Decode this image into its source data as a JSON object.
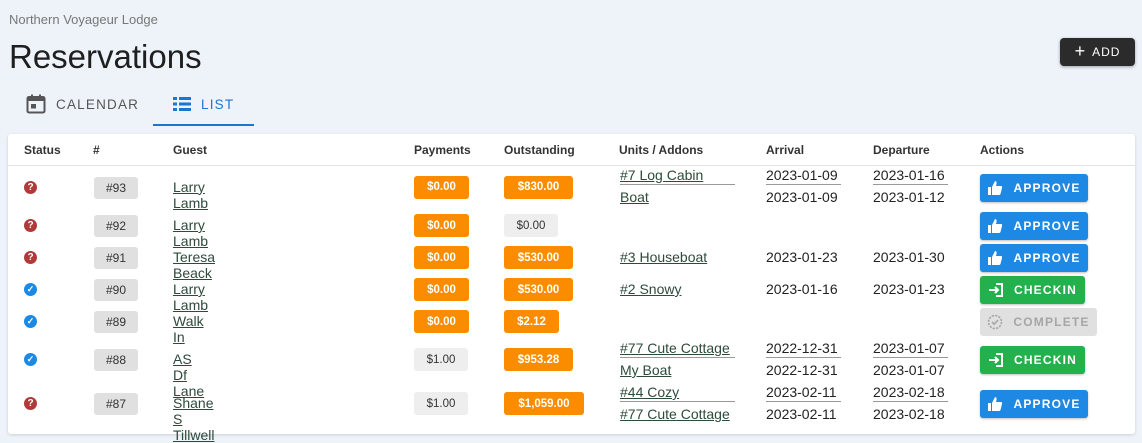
{
  "app": {
    "org_name": "Northern Voyageur Lodge",
    "page_title": "Reservations"
  },
  "toolbar": {
    "add_label": "ADD"
  },
  "tabs": [
    {
      "label": "CALENDAR",
      "icon": "calendar-icon",
      "active": false
    },
    {
      "label": "LIST",
      "icon": "list-icon",
      "active": true
    }
  ],
  "table": {
    "columns": [
      "Status",
      "#",
      "Guest",
      "Payments",
      "Outstanding",
      "Units / Addons",
      "Arrival",
      "Departure",
      "Actions"
    ],
    "rows": [
      {
        "status": "pending",
        "id": "#93",
        "guest": "Larry Lamb",
        "payments": "$0.00",
        "payments_color": "orange",
        "outstanding": "$830.00",
        "outstanding_color": "orange",
        "units": [
          "#7 Log Cabin",
          "Boat"
        ],
        "arrival": [
          "2023-01-09",
          "2023-01-09"
        ],
        "departure": [
          "2023-01-16",
          "2023-01-12"
        ],
        "action": "APPROVE",
        "action_type": "approve"
      },
      {
        "status": "pending",
        "id": "#92",
        "guest": "Larry Lamb",
        "payments": "$0.00",
        "payments_color": "orange",
        "outstanding": "$0.00",
        "outstanding_color": "gray",
        "units": [],
        "arrival": [],
        "departure": [],
        "action": "APPROVE",
        "action_type": "approve"
      },
      {
        "status": "pending",
        "id": "#91",
        "guest": "Teresa Beack",
        "payments": "$0.00",
        "payments_color": "orange",
        "outstanding": "$530.00",
        "outstanding_color": "orange",
        "units": [
          "#3 Houseboat"
        ],
        "arrival": [
          "2023-01-23"
        ],
        "departure": [
          "2023-01-30"
        ],
        "action": "APPROVE",
        "action_type": "approve"
      },
      {
        "status": "confirmed",
        "id": "#90",
        "guest": "Larry Lamb",
        "payments": "$0.00",
        "payments_color": "orange",
        "outstanding": "$530.00",
        "outstanding_color": "orange",
        "units": [
          "#2 Snowy"
        ],
        "arrival": [
          "2023-01-16"
        ],
        "departure": [
          "2023-01-23"
        ],
        "action": "CHECKIN",
        "action_type": "checkin"
      },
      {
        "status": "confirmed",
        "id": "#89",
        "guest": "Walk In",
        "payments": "$0.00",
        "payments_color": "orange",
        "outstanding": "$2.12",
        "outstanding_color": "orange",
        "units": [],
        "arrival": [],
        "departure": [],
        "action": "COMPLETE",
        "action_type": "complete"
      },
      {
        "status": "confirmed",
        "id": "#88",
        "guest": "AS Df Lane",
        "payments": "$1.00",
        "payments_color": "gray",
        "outstanding": "$953.28",
        "outstanding_color": "orange",
        "units": [
          "#77 Cute Cottage",
          "My Boat"
        ],
        "arrival": [
          "2022-12-31",
          "2022-12-31"
        ],
        "departure": [
          "2023-01-07",
          "2023-01-07"
        ],
        "action": "CHECKIN",
        "action_type": "checkin"
      },
      {
        "status": "pending",
        "id": "#87",
        "guest": "Shane S Tillwell",
        "payments": "$1.00",
        "payments_color": "gray",
        "outstanding": "$1,059.00",
        "outstanding_color": "orange",
        "units": [
          "#44 Cozy",
          "#77 Cute Cottage"
        ],
        "arrival": [
          "2023-02-11",
          "2023-02-11"
        ],
        "departure": [
          "2023-02-18",
          "2023-02-18"
        ],
        "action": "APPROVE",
        "action_type": "approve"
      }
    ]
  }
}
